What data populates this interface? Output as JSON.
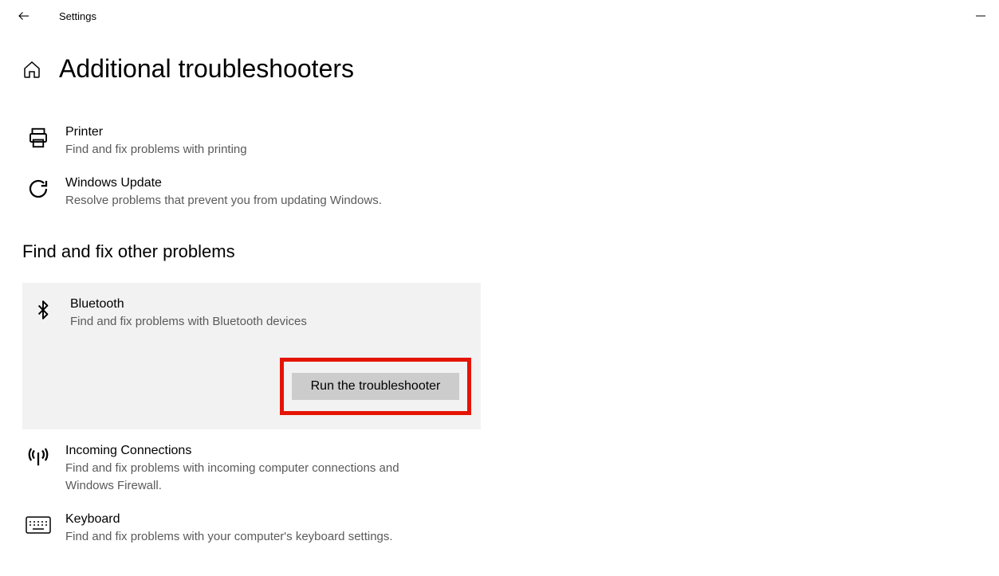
{
  "titlebar": {
    "title": "Settings"
  },
  "page_title": "Additional troubleshooters",
  "items_top": [
    {
      "title": "Printer",
      "desc": "Find and fix problems with printing"
    },
    {
      "title": "Windows Update",
      "desc": "Resolve problems that prevent you from updating Windows."
    }
  ],
  "section_heading": "Find and fix other problems",
  "expanded": {
    "title": "Bluetooth",
    "desc": "Find and fix problems with Bluetooth devices",
    "button": "Run the troubleshooter"
  },
  "items_bottom": [
    {
      "title": "Incoming Connections",
      "desc": "Find and fix problems with incoming computer connections and Windows Firewall."
    },
    {
      "title": "Keyboard",
      "desc": "Find and fix problems with your computer's keyboard settings."
    }
  ]
}
